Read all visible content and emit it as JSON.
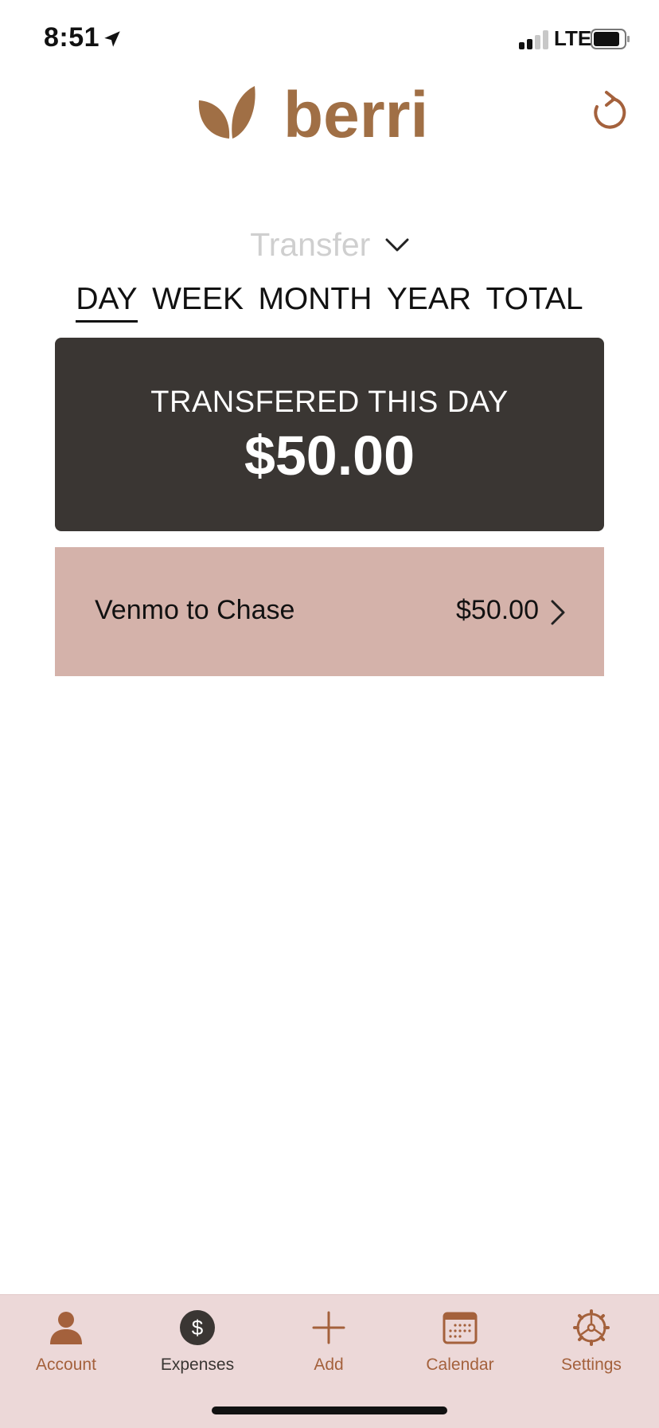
{
  "status_bar": {
    "time": "8:51",
    "network": "LTE"
  },
  "header": {
    "logo_text": "berri",
    "refresh_icon": "refresh-icon"
  },
  "category_selector": {
    "value": "Transfer",
    "icon": "chevron-down-icon"
  },
  "period_tabs": [
    {
      "label": "DAY",
      "active": true
    },
    {
      "label": "WEEK",
      "active": false
    },
    {
      "label": "MONTH",
      "active": false
    },
    {
      "label": "YEAR",
      "active": false
    },
    {
      "label": "TOTAL",
      "active": false
    }
  ],
  "summary": {
    "title": "TRANSFERED THIS DAY",
    "amount": "$50.00"
  },
  "transactions": [
    {
      "name": "Venmo to Chase",
      "amount": "$50.00"
    }
  ],
  "tab_bar": {
    "items": [
      {
        "label": "Account",
        "icon": "person-icon",
        "active": false
      },
      {
        "label": "Expenses",
        "icon": "dollar-icon",
        "active": true
      },
      {
        "label": "Add",
        "icon": "plus-icon",
        "active": false
      },
      {
        "label": "Calendar",
        "icon": "calendar-icon",
        "active": false
      },
      {
        "label": "Settings",
        "icon": "gear-icon",
        "active": false
      }
    ]
  },
  "colors": {
    "brand": "#a06f45",
    "card_dark": "#3a3633",
    "row_background": "#d4b2aa",
    "tab_bar_background": "#ecd8d8",
    "tab_accent": "#a4613c"
  }
}
